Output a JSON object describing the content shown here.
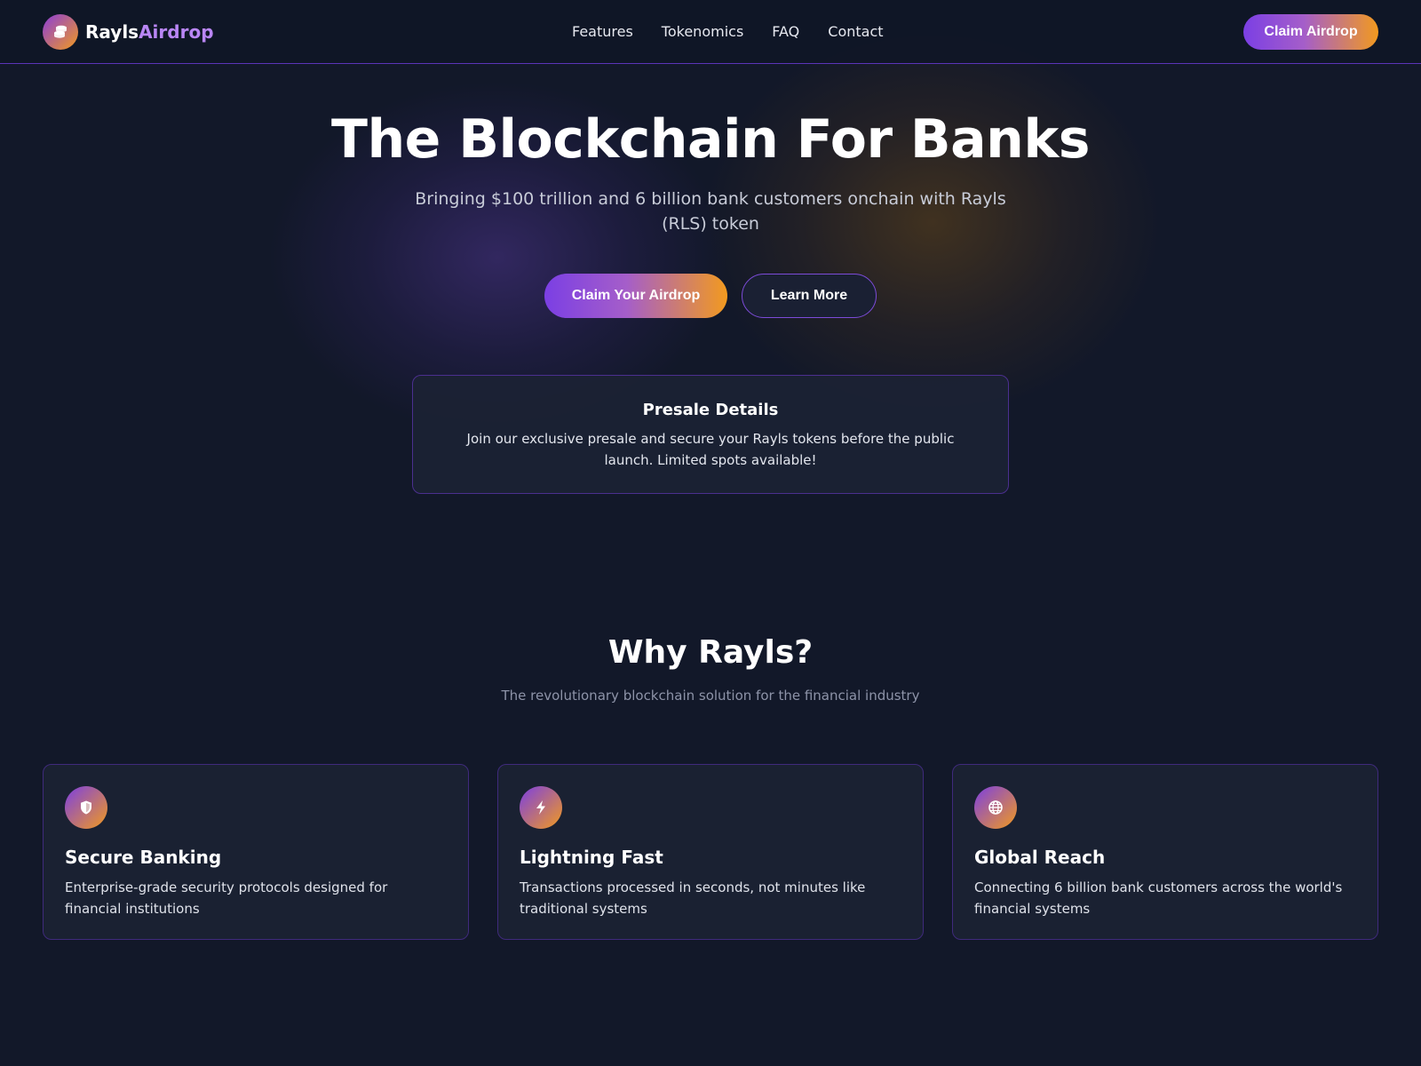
{
  "nav": {
    "logo_main": "Rayls",
    "logo_accent": "Airdrop",
    "logo_icon": "coins-icon",
    "links": [
      "Features",
      "Tokenomics",
      "FAQ",
      "Contact"
    ],
    "cta_label": "Claim Airdrop"
  },
  "hero": {
    "title": "The Blockchain For Banks",
    "subtitle": "Bringing $100 trillion and 6 billion bank customers onchain with Rayls (RLS) token",
    "primary_button": "Claim Your Airdrop",
    "secondary_button": "Learn More"
  },
  "presale": {
    "title": "Presale Details",
    "text": "Join our exclusive presale and secure your Rayls tokens before the public launch. Limited spots available!"
  },
  "why": {
    "title": "Why Rayls?",
    "subtitle": "The revolutionary blockchain solution for the financial industry",
    "cards": [
      {
        "icon": "shield-icon",
        "title": "Secure Banking",
        "text": "Enterprise-grade security protocols designed for financial institutions"
      },
      {
        "icon": "lightning-icon",
        "title": "Lightning Fast",
        "text": "Transactions processed in seconds, not minutes like traditional systems"
      },
      {
        "icon": "globe-icon",
        "title": "Global Reach",
        "text": "Connecting 6 billion bank customers across the world's financial systems"
      }
    ]
  },
  "colors": {
    "background": "#121829",
    "accent_purple": "#7b3fe4",
    "accent_orange": "#f29a1f",
    "logo_accent": "#b986f5"
  }
}
